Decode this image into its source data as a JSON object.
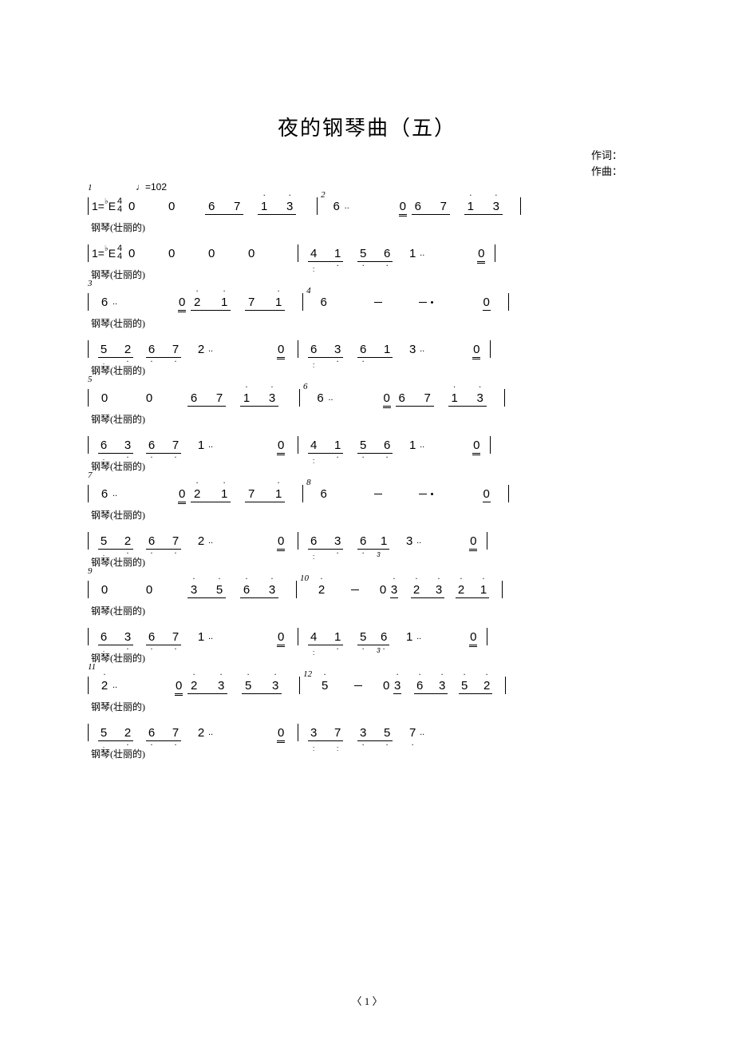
{
  "title": "夜的钢琴曲（五）",
  "credits": {
    "lyrics_label": "作词：",
    "music_label": "作曲："
  },
  "tempo_marking": "♩=102",
  "key_signature": "1=♭E",
  "time_signature": {
    "top": "4",
    "bottom": "4"
  },
  "instrument_label": "钢琴(壮丽的)",
  "page_number": "〈 1 〉",
  "systems": [
    {
      "measure_start": 1,
      "upper": {
        "m1": [
          "0",
          "0",
          "6",
          "7",
          "1̇",
          "3̇"
        ],
        "m2": [
          "6..",
          "0̲",
          "6",
          "7",
          "1̇",
          "3̇"
        ]
      },
      "lower": {
        "m1": [
          "0",
          "0",
          "0",
          "0"
        ],
        "m2": [
          "4̣",
          "1",
          "5̣",
          "6̣",
          "1..",
          "0̲"
        ]
      }
    },
    {
      "measure_start": 3,
      "upper": {
        "m1": [
          "6..",
          "0̲",
          "2̇",
          "1̇",
          "7",
          "1̇"
        ],
        "m2": [
          "6",
          "–",
          "–.",
          "0̲"
        ]
      },
      "lower": {
        "m1": [
          "5̣",
          "2",
          "6̣",
          "7̣",
          "2..",
          "0̲"
        ],
        "m2": [
          "6̣",
          "3",
          "6̣",
          "1",
          "3..",
          "0̲"
        ]
      }
    },
    {
      "measure_start": 5,
      "upper": {
        "m1": [
          "0",
          "0",
          "6",
          "7",
          "1̇",
          "3̇"
        ],
        "m2": [
          "6..",
          "0̲",
          "6",
          "7",
          "1̇",
          "3̇"
        ]
      },
      "lower": {
        "m1": [
          "6̣",
          "3",
          "6̣",
          "7̣",
          "1..",
          "0̲"
        ],
        "m2": [
          "4̣",
          "1",
          "5̣",
          "6̣",
          "1..",
          "0̲"
        ]
      }
    },
    {
      "measure_start": 7,
      "upper": {
        "m1": [
          "6..",
          "0̲",
          "2̇",
          "1̇",
          "7",
          "1̇"
        ],
        "m2": [
          "6",
          "–",
          "–.",
          "0̲"
        ]
      },
      "lower": {
        "m1": [
          "5̣",
          "2",
          "6̣",
          "7̣",
          "2..",
          "0̲"
        ],
        "m2": [
          "6̣",
          "3",
          "6̣",
          "1",
          "3..",
          "0̲"
        ]
      }
    },
    {
      "measure_start": 9,
      "upper": {
        "m1": [
          "0",
          "0",
          "3̇",
          "5̇",
          "6̇",
          "3̇"
        ],
        "m2": [
          "2̇",
          "–",
          "0",
          "3̇",
          "2̲̇",
          "3̇",
          "2̇",
          "1̇"
        ]
      },
      "lower": {
        "m1": [
          "6̣",
          "3",
          "6̣",
          "7̣",
          "1..",
          "0̲"
        ],
        "m2": [
          "4̣",
          "1",
          "5̣",
          "6̣",
          "1..",
          "0̲"
        ]
      }
    },
    {
      "measure_start": 11,
      "upper": {
        "m1": [
          "2̇..",
          "0̲",
          "2̇",
          "3̇",
          "5̇",
          "3̇"
        ],
        "m2": [
          "5̇",
          "–",
          "0",
          "3̇",
          "6̲̇",
          "3̇",
          "5̇",
          "2̇"
        ]
      },
      "lower": {
        "m1": [
          "5̣",
          "2",
          "6̣",
          "7̣",
          "2..",
          "0̲"
        ],
        "m2": [
          "3̣",
          "7̣",
          "3̣",
          "5̣",
          "7̣.."
        ]
      }
    }
  ]
}
